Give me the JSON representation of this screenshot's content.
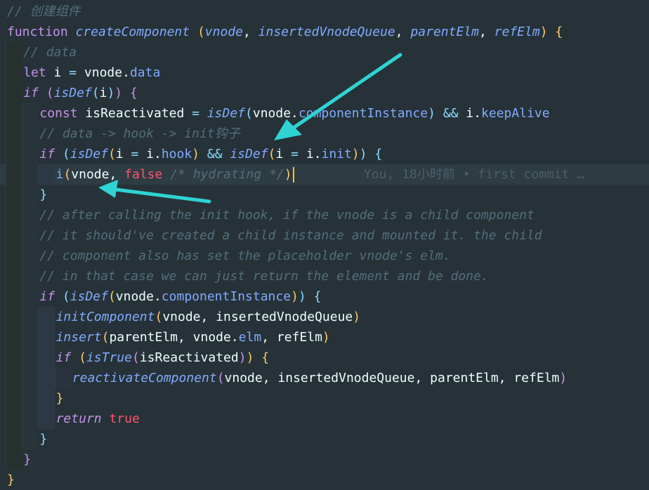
{
  "editor": {
    "colors": {
      "background": "#263238",
      "comment": "#546e7a",
      "keyword": "#c792ea",
      "function": "#82aaff",
      "boolean": "#ff5370",
      "annotation_arrow": "#2fd3d3"
    },
    "lines": [
      {
        "indent": 0,
        "tokens": [
          [
            "comment",
            "// 创建组件"
          ]
        ]
      },
      {
        "indent": 0,
        "tokens": [
          [
            "kw",
            "function "
          ],
          [
            "fn-i",
            "createComponent"
          ],
          [
            "plain",
            " "
          ],
          [
            "p1",
            "("
          ],
          [
            "param",
            "vnode"
          ],
          [
            "plain",
            ", "
          ],
          [
            "param",
            "insertedVnodeQueue"
          ],
          [
            "plain",
            ", "
          ],
          [
            "param",
            "parentElm"
          ],
          [
            "plain",
            ", "
          ],
          [
            "param",
            "refElm"
          ],
          [
            "p1",
            ")"
          ],
          [
            "plain",
            " "
          ],
          [
            "p1",
            "{"
          ]
        ]
      },
      {
        "indent": 1,
        "tokens": [
          [
            "comment",
            "// data"
          ]
        ]
      },
      {
        "indent": 1,
        "tokens": [
          [
            "kw",
            "let "
          ],
          [
            "plain",
            "i "
          ],
          [
            "op",
            "="
          ],
          [
            "plain",
            " vnode."
          ],
          [
            "prop",
            "data"
          ]
        ]
      },
      {
        "indent": 1,
        "tokens": [
          [
            "kw-i",
            "if"
          ],
          [
            "plain",
            " "
          ],
          [
            "p2",
            "("
          ],
          [
            "fn-i",
            "isDef"
          ],
          [
            "p3",
            "("
          ],
          [
            "plain",
            "i"
          ],
          [
            "p3",
            ")"
          ],
          [
            "p2",
            ")"
          ],
          [
            "plain",
            " "
          ],
          [
            "p2",
            "{"
          ]
        ]
      },
      {
        "indent": 2,
        "tokens": [
          [
            "kw",
            "const "
          ],
          [
            "plain",
            "isReactivated "
          ],
          [
            "op",
            "="
          ],
          [
            "plain",
            " "
          ],
          [
            "fn-i",
            "isDef"
          ],
          [
            "p3",
            "("
          ],
          [
            "plain",
            "vnode."
          ],
          [
            "prop",
            "componentInstance"
          ],
          [
            "p3",
            ")"
          ],
          [
            "plain",
            " "
          ],
          [
            "op",
            "&&"
          ],
          [
            "plain",
            " i."
          ],
          [
            "prop",
            "keepAlive"
          ]
        ]
      },
      {
        "indent": 2,
        "tokens": [
          [
            "comment",
            "// data -> hook -> init钩子"
          ]
        ]
      },
      {
        "indent": 2,
        "tokens": [
          [
            "kw-i",
            "if"
          ],
          [
            "plain",
            " "
          ],
          [
            "p3",
            "("
          ],
          [
            "fn-i",
            "isDef"
          ],
          [
            "p1",
            "("
          ],
          [
            "plain",
            "i "
          ],
          [
            "op",
            "="
          ],
          [
            "plain",
            " i."
          ],
          [
            "prop",
            "hook"
          ],
          [
            "p1",
            ")"
          ],
          [
            "plain",
            " "
          ],
          [
            "op",
            "&&"
          ],
          [
            "plain",
            " "
          ],
          [
            "fn-i",
            "isDef"
          ],
          [
            "p1",
            "("
          ],
          [
            "plain",
            "i "
          ],
          [
            "op",
            "="
          ],
          [
            "plain",
            " i."
          ],
          [
            "prop",
            "init"
          ],
          [
            "p1",
            ")"
          ],
          [
            "p3",
            ")"
          ],
          [
            "plain",
            " "
          ],
          [
            "p3",
            "{"
          ]
        ]
      },
      {
        "indent": 3,
        "current": true,
        "tokens": [
          [
            "fn",
            "i"
          ],
          [
            "p1",
            "("
          ],
          [
            "plain",
            "vnode"
          ],
          [
            "plain",
            ", "
          ],
          [
            "bool",
            "false"
          ],
          [
            "plain",
            " "
          ],
          [
            "comment",
            "/* hydrating */"
          ],
          [
            "p1",
            ")"
          ]
        ]
      },
      {
        "indent": 2,
        "tokens": [
          [
            "p3",
            "}"
          ]
        ]
      },
      {
        "indent": 2,
        "tokens": [
          [
            "comment",
            "// after calling the init hook, if the vnode is a child component"
          ]
        ]
      },
      {
        "indent": 2,
        "tokens": [
          [
            "comment",
            "// it should've created a child instance and mounted it. the child"
          ]
        ]
      },
      {
        "indent": 2,
        "tokens": [
          [
            "comment",
            "// component also has set the placeholder vnode's elm."
          ]
        ]
      },
      {
        "indent": 2,
        "tokens": [
          [
            "comment",
            "// in that case we can just return the element and be done."
          ]
        ]
      },
      {
        "indent": 2,
        "tokens": [
          [
            "kw-i",
            "if"
          ],
          [
            "plain",
            " "
          ],
          [
            "p3",
            "("
          ],
          [
            "fn-i",
            "isDef"
          ],
          [
            "p1",
            "("
          ],
          [
            "plain",
            "vnode."
          ],
          [
            "prop",
            "componentInstance"
          ],
          [
            "p1",
            ")"
          ],
          [
            "p3",
            ")"
          ],
          [
            "plain",
            " "
          ],
          [
            "p3",
            "{"
          ]
        ]
      },
      {
        "indent": 3,
        "tokens": [
          [
            "fn-i",
            "initComponent"
          ],
          [
            "p1",
            "("
          ],
          [
            "plain",
            "vnode, insertedVnodeQueue"
          ],
          [
            "p1",
            ")"
          ]
        ]
      },
      {
        "indent": 3,
        "tokens": [
          [
            "fn-i",
            "insert"
          ],
          [
            "p1",
            "("
          ],
          [
            "plain",
            "parentElm, vnode."
          ],
          [
            "prop",
            "elm"
          ],
          [
            "plain",
            ", refElm"
          ],
          [
            "p1",
            ")"
          ]
        ]
      },
      {
        "indent": 3,
        "tokens": [
          [
            "kw-i",
            "if"
          ],
          [
            "plain",
            " "
          ],
          [
            "p1",
            "("
          ],
          [
            "fn-i",
            "isTrue"
          ],
          [
            "p2",
            "("
          ],
          [
            "plain",
            "isReactivated"
          ],
          [
            "p2",
            ")"
          ],
          [
            "p1",
            ")"
          ],
          [
            "plain",
            " "
          ],
          [
            "p1",
            "{"
          ]
        ]
      },
      {
        "indent": 4,
        "tokens": [
          [
            "fn-i",
            "reactivateComponent"
          ],
          [
            "p2",
            "("
          ],
          [
            "plain",
            "vnode, insertedVnodeQueue, parentElm, refElm"
          ],
          [
            "p2",
            ")"
          ]
        ]
      },
      {
        "indent": 3,
        "tokens": [
          [
            "p1",
            "}"
          ]
        ]
      },
      {
        "indent": 3,
        "tokens": [
          [
            "kw-i",
            "return"
          ],
          [
            "plain",
            " "
          ],
          [
            "bool",
            "true"
          ]
        ]
      },
      {
        "indent": 2,
        "tokens": [
          [
            "p3",
            "}"
          ]
        ]
      },
      {
        "indent": 1,
        "tokens": [
          [
            "p2",
            "}"
          ]
        ]
      },
      {
        "indent": 0,
        "tokens": [
          [
            "p1",
            "}"
          ]
        ]
      }
    ],
    "blame": {
      "line": 8,
      "text": "You, 18小时前 • first commit …"
    }
  }
}
